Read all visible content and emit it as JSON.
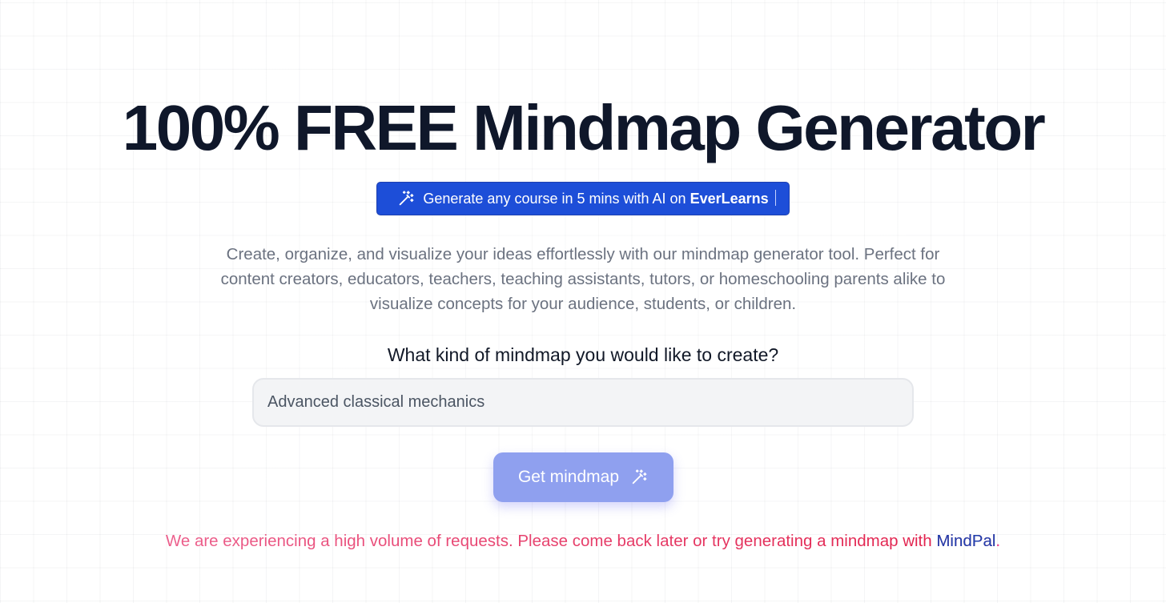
{
  "hero": {
    "title": "100% FREE Mindmap Generator"
  },
  "promo": {
    "text": "Generate any course in 5 mins with AI on ",
    "brand": "EverLearns",
    "icon": "magic-wand-icon"
  },
  "description": "Create, organize, and visualize your ideas effortlessly with our mindmap generator tool. Perfect for content creators, educators, teachers, teaching assistants, tutors, or homeschooling parents alike to visualize concepts for your audience, students, or children.",
  "form": {
    "question": "What kind of mindmap you would like to create?",
    "input_value": "Advanced classical mechanics",
    "button_label": "Get mindmap",
    "button_icon": "magic-wand-icon"
  },
  "notice": {
    "text": "We are experiencing a high volume of requests. Please come back later or try generating a mindmap with ",
    "link_text": "MindPal",
    "suffix": "."
  },
  "colors": {
    "promo_bg": "#1d4ed8",
    "button_bg": "#8fa0ef",
    "notice": "#e11d48",
    "link": "#1e40af"
  }
}
